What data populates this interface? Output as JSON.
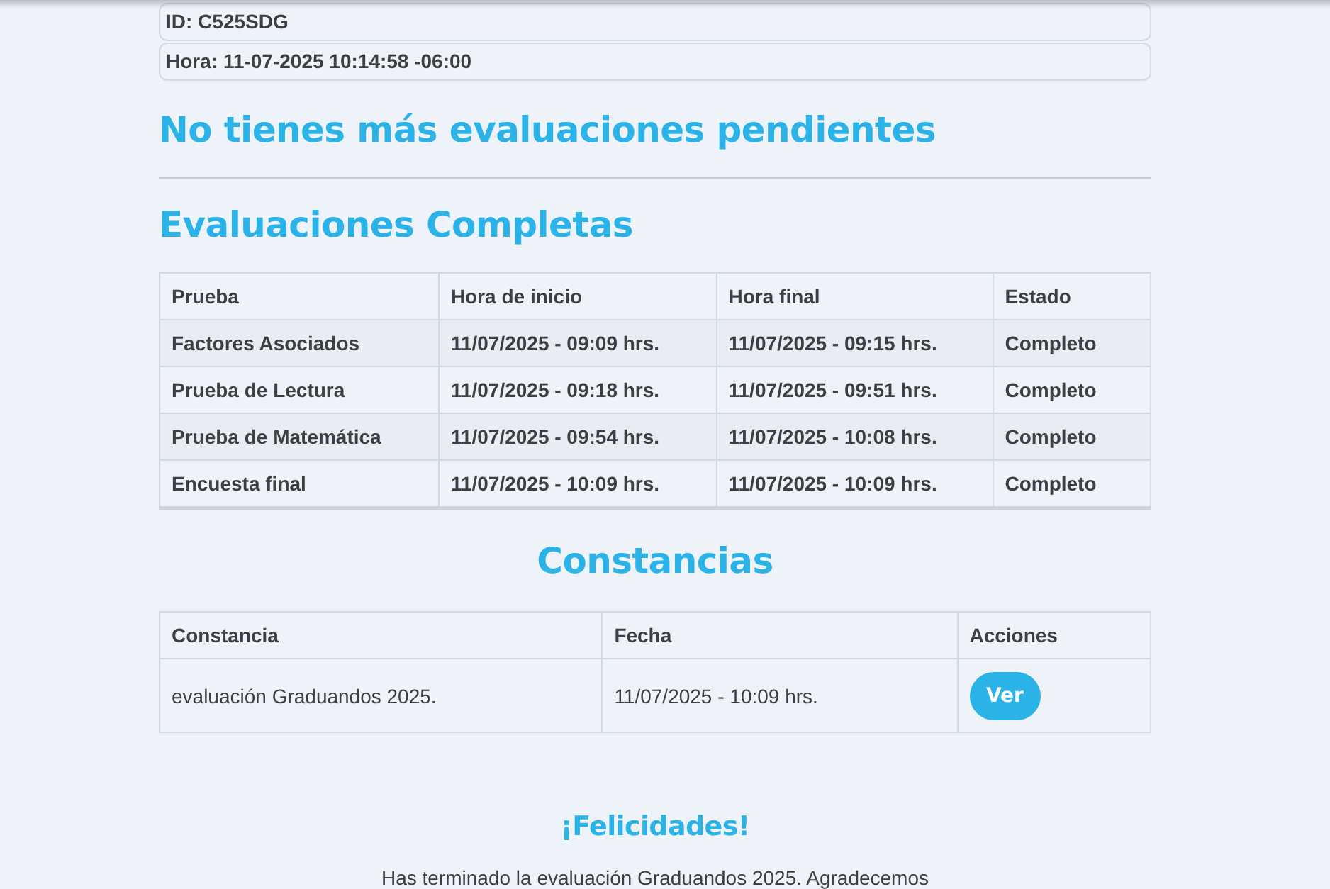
{
  "info": [
    {
      "text": "ID: C525SDG"
    },
    {
      "text": "Hora: 11-07-2025 10:14:58 -06:00"
    }
  ],
  "pending_title": "No tienes más evaluaciones pendientes",
  "completed": {
    "title": "Evaluaciones Completas",
    "columns": [
      "Prueba",
      "Hora de inicio",
      "Hora final",
      "Estado"
    ],
    "rows": [
      [
        "Factores Asociados",
        "11/07/2025 - 09:09 hrs.",
        "11/07/2025 - 09:15 hrs.",
        "Completo"
      ],
      [
        "Prueba de Lectura",
        "11/07/2025 - 09:18 hrs.",
        "11/07/2025 - 09:51 hrs.",
        "Completo"
      ],
      [
        "Prueba de Matemática",
        "11/07/2025 - 09:54 hrs.",
        "11/07/2025 - 10:08 hrs.",
        "Completo"
      ],
      [
        "Encuesta final",
        "11/07/2025 - 10:09 hrs.",
        "11/07/2025 - 10:09 hrs.",
        "Completo"
      ]
    ]
  },
  "certificates": {
    "title": "Constancias",
    "columns": [
      "Constancia",
      "Fecha",
      "Acciones"
    ],
    "rows": [
      {
        "name": "evaluación Graduandos 2025.",
        "date": "11/07/2025 - 10:09 hrs.",
        "action": "Ver"
      }
    ]
  },
  "congrats": {
    "title": "¡Felicidades!",
    "text": "Has terminado la evaluación Graduandos 2025. Agradecemos"
  }
}
